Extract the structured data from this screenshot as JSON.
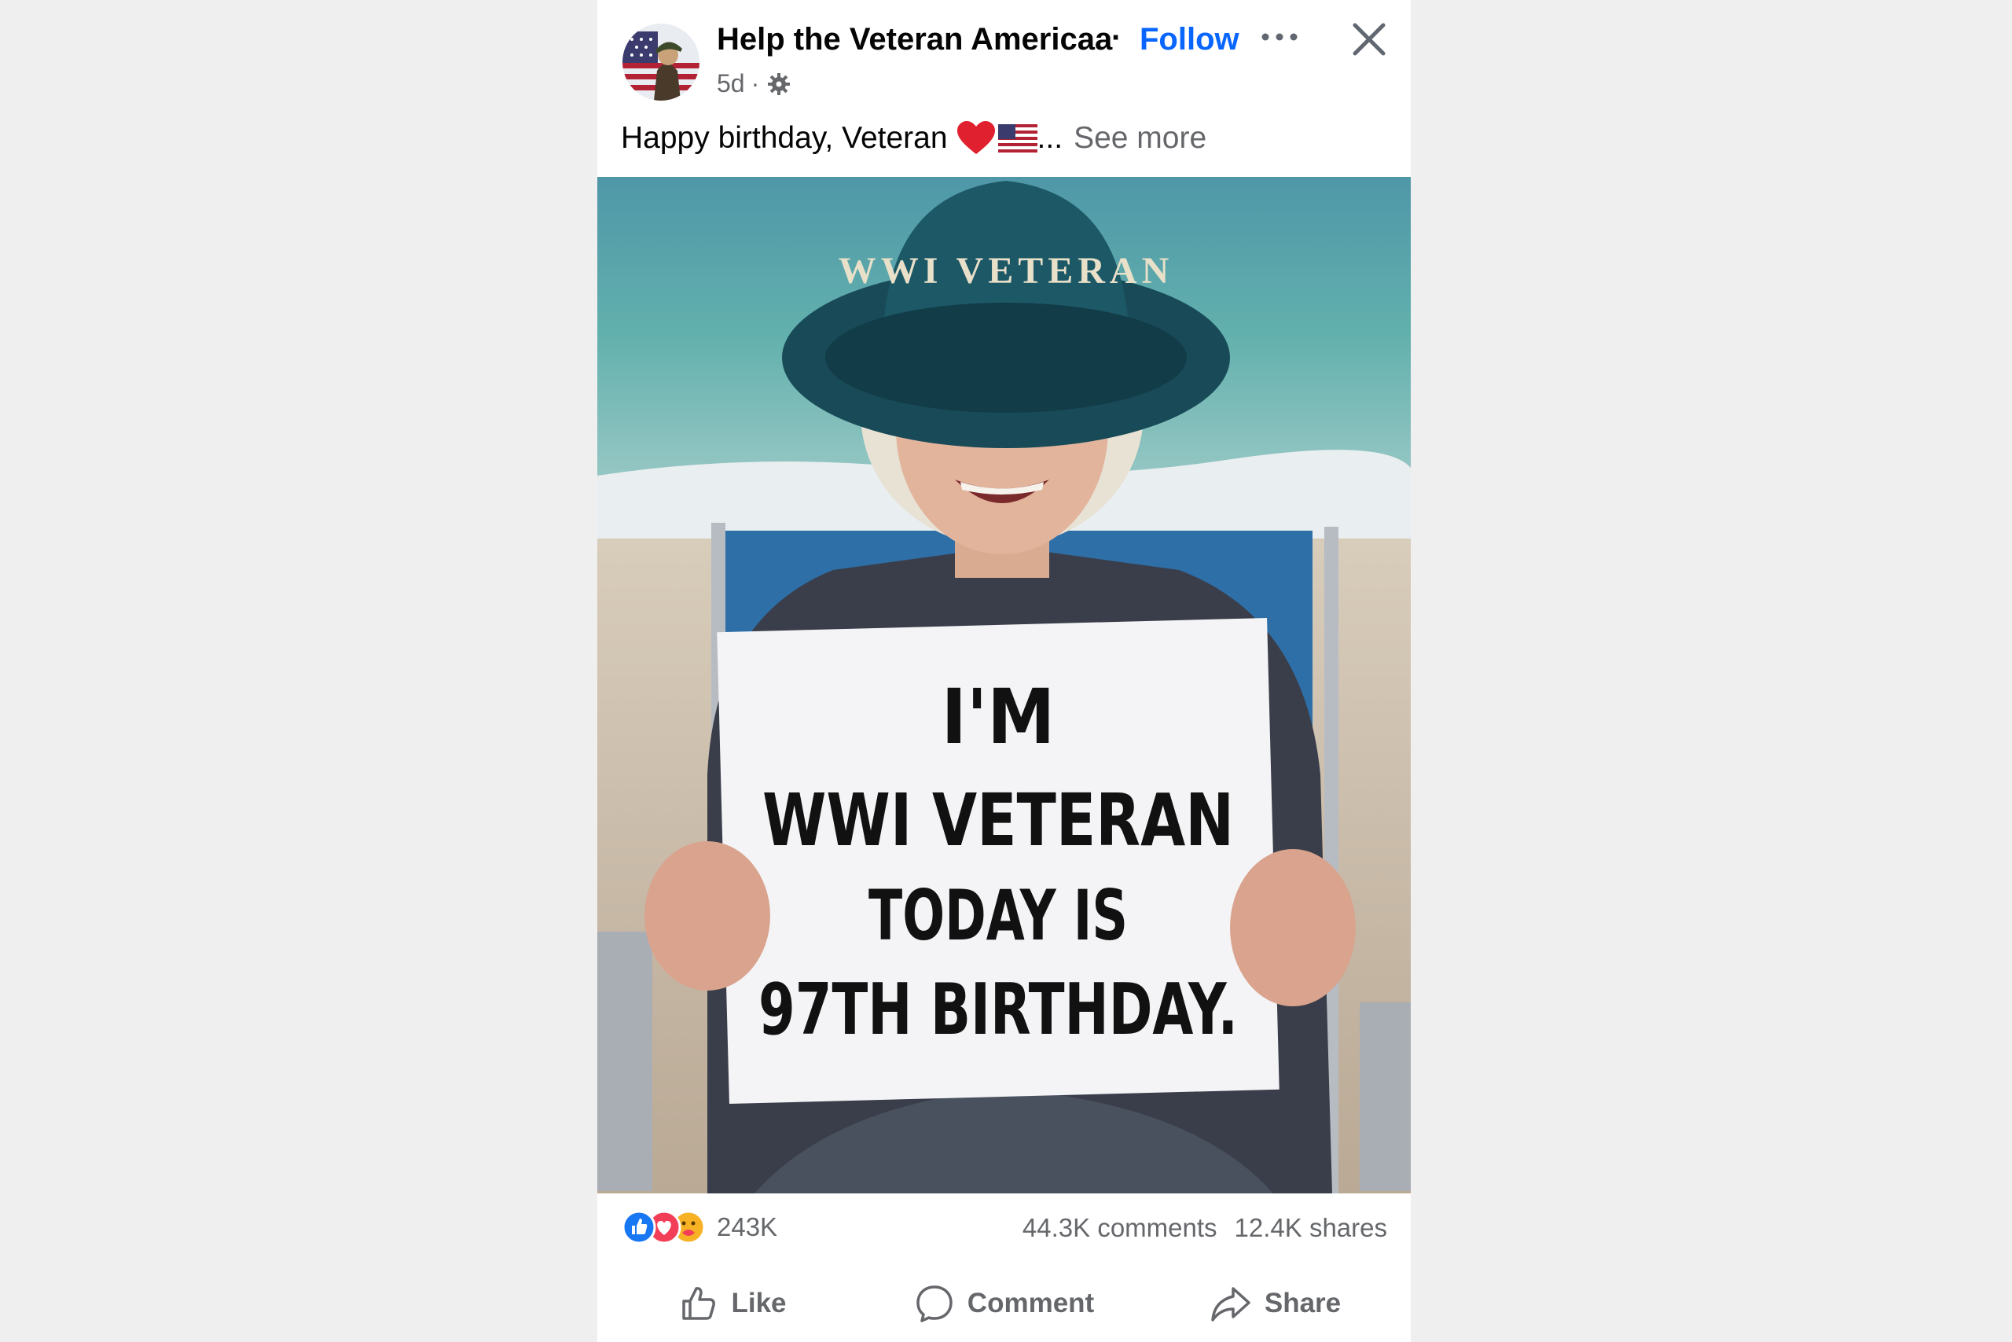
{
  "post": {
    "page_name": "Help the Veteran Americaa",
    "separator": "·",
    "follow_label": "Follow",
    "time_ago": "5d",
    "meta_separator": "·",
    "caption_text": "Happy birthday, Veteran",
    "caption_ellipsis": "...",
    "see_more_label": "See more"
  },
  "photo": {
    "hat_text": "WWI VETERAN",
    "sign_lines": [
      "I'M",
      "WWI VETERAN",
      "TODAY IS",
      "97TH BIRTHDAY."
    ]
  },
  "engagement": {
    "reaction_count": "243K",
    "comments": "44.3K comments",
    "shares": "12.4K shares",
    "reaction_icons": [
      "like-icon",
      "love-icon",
      "care-icon"
    ]
  },
  "actions": {
    "like_label": "Like",
    "comment_label": "Comment",
    "share_label": "Share"
  },
  "colors": {
    "accent": "#0866ff",
    "secondary_text": "#65676b",
    "like_blue": "#1877f2",
    "love_red": "#f33e58",
    "care_yellow": "#f7b125"
  }
}
